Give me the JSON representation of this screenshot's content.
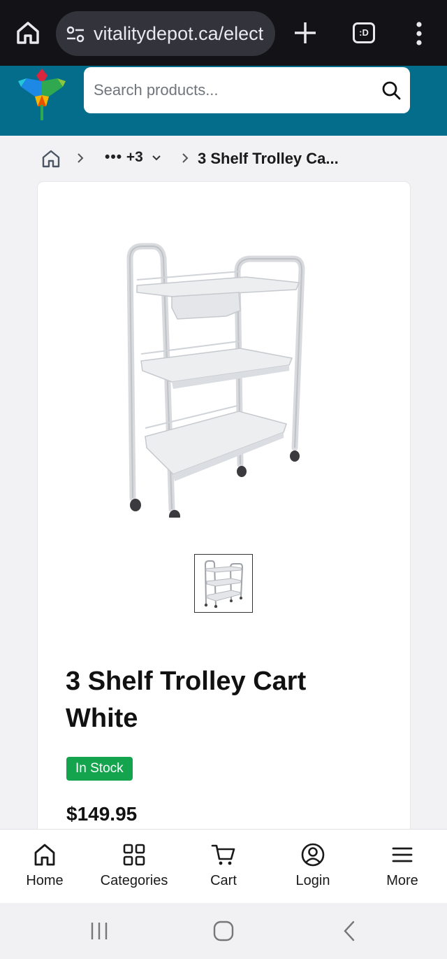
{
  "browser": {
    "url": "vitalitydepot.ca/elect",
    "tab_label": ":D"
  },
  "header": {
    "search_placeholder": "Search products..."
  },
  "breadcrumb": {
    "more_dots": "•••",
    "more_count": "+3",
    "current": "3 Shelf Trolley Ca..."
  },
  "product": {
    "title": "3 Shelf Trolley Cart White",
    "stock_status": "In Stock",
    "price": "$149.95"
  },
  "bottom_nav": {
    "items": [
      {
        "label": "Home",
        "icon": "home-icon"
      },
      {
        "label": "Categories",
        "icon": "grid-icon"
      },
      {
        "label": "Cart",
        "icon": "cart-icon"
      },
      {
        "label": "Login",
        "icon": "user-circle-icon"
      },
      {
        "label": "More",
        "icon": "hamburger-icon"
      }
    ]
  },
  "colors": {
    "browser_bar": "#121217",
    "header": "#046d8b",
    "stock_badge": "#14a44d"
  }
}
